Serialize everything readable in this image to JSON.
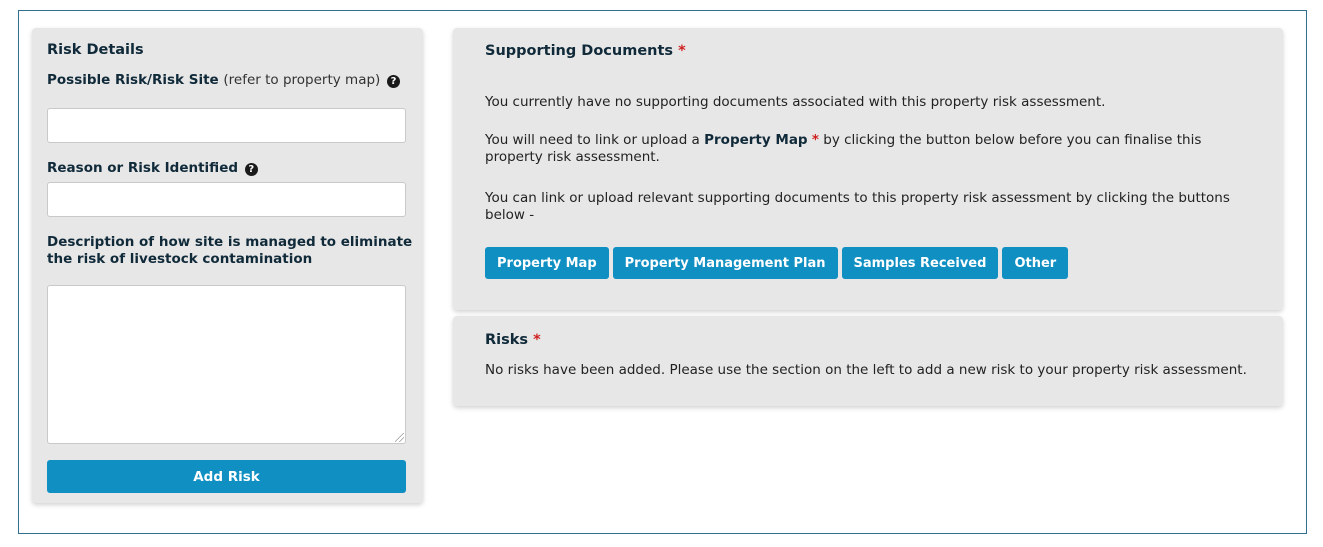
{
  "risk_details": {
    "title": "Risk Details",
    "possible_risk_label": "Possible Risk/Risk Site",
    "possible_risk_hint": "(refer to property map)",
    "possible_risk_value": "",
    "reason_label": "Reason or Risk Identified",
    "reason_value": "",
    "description_label_line1": "Description of how site is managed to eliminate",
    "description_label_line2": "the risk of livestock contamination",
    "description_value": "",
    "add_button": "Add Risk"
  },
  "supporting_documents": {
    "title": "Supporting Documents",
    "required_mark": "*",
    "no_docs_text": "You currently have no supporting documents associated with this property risk assessment.",
    "need_link_prefix": "You will need to link or upload a",
    "need_link_bold": "Property Map",
    "need_link_suffix_line1": "by clicking the button below before you can finalise this",
    "need_link_suffix_line2": "property risk assessment.",
    "can_link_line1": "You can link or upload relevant supporting documents to this property risk assessment by clicking the buttons",
    "can_link_line2": "below -",
    "buttons": [
      "Property Map",
      "Property Management Plan",
      "Samples Received",
      "Other"
    ]
  },
  "risks": {
    "title": "Risks",
    "required_mark": "*",
    "empty_text": "No risks have been added. Please use the section on the left to add a new risk to your property risk assessment."
  },
  "colors": {
    "button": "#0f8fc2",
    "panel": "#e7e7e7",
    "required": "#d01f1f",
    "frame_border": "#2f6f8f"
  },
  "icons": {
    "help": "question-circle-icon",
    "resize": "resize-grip-icon"
  }
}
